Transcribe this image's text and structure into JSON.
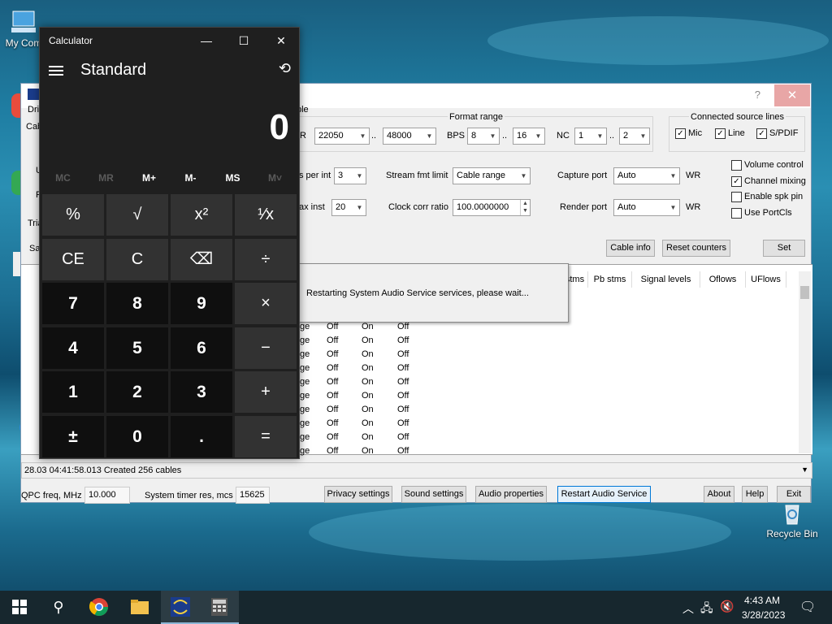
{
  "desktop": {
    "icons": [
      {
        "label": "My Com"
      },
      {
        "label": "Recycle Bin"
      }
    ]
  },
  "vac": {
    "title_help": "?",
    "close": "✕",
    "partial_labels": {
      "drv": "Driv",
      "cab": "Cab",
      "u": "U",
      "p": "P",
      "tria": "Tria",
      "sa": "Sa",
      "ca": "Ca",
      "ble": "ble",
      "r": "R"
    },
    "format_range": {
      "title": "Format range",
      "sr_from": "22050",
      "sr_to": "48000",
      "dots": "..",
      "bps_label": "BPS",
      "bps_from": "8",
      "bps_to": "16",
      "nc_label": "NC",
      "nc_from": "1",
      "nc_to": "2"
    },
    "connected": {
      "title": "Connected source lines",
      "mic": "Mic",
      "line": "Line",
      "spdif": "S/PDIF"
    },
    "settings": {
      "s_per_int_label": "s per int",
      "s_per_int": "3",
      "ax_inst_label": "ax inst",
      "ax_inst": "20",
      "stream_fmt_label": "Stream fmt limit",
      "stream_fmt": "Cable range",
      "clock_label": "Clock corr ratio",
      "clock": "100.0000000",
      "capture_label": "Capture port",
      "capture": "Auto",
      "capture_wr": "WR",
      "render_label": "Render port",
      "render": "Auto",
      "render_wr": "WR"
    },
    "options": {
      "volume": "Volume control",
      "mixing": "Channel mixing",
      "spk_pin": "Enable spk pin",
      "portcls": "Use PortCls"
    },
    "buttons": {
      "cable_info": "Cable info",
      "reset": "Reset counters",
      "set": "Set"
    },
    "table": {
      "headers": [
        "stms",
        "Pb stms",
        "Signal levels",
        "Oflows",
        "UFlows"
      ],
      "rows": [
        [
          "ge",
          "Off",
          "On",
          "Off"
        ],
        [
          "ge",
          "Off",
          "On",
          "Off"
        ],
        [
          "ge",
          "Off",
          "On",
          "Off"
        ],
        [
          "ge",
          "Off",
          "On",
          "Off"
        ],
        [
          "ge",
          "Off",
          "On",
          "Off"
        ],
        [
          "ge",
          "Off",
          "On",
          "Off"
        ],
        [
          "ge",
          "Off",
          "On",
          "Off"
        ],
        [
          "ge",
          "Off",
          "On",
          "Off"
        ],
        [
          "ge",
          "Off",
          "On",
          "Off"
        ],
        [
          "ge",
          "Off",
          "On",
          "Off"
        ]
      ]
    },
    "dialog": "Restarting System Audio Service services, please wait...",
    "status": "28.03   04:41:58.013  Created 256 cables",
    "bottom": {
      "qpc_label": "QPC freq, MHz",
      "qpc": "10.000",
      "timer_label": "System timer res, mcs",
      "timer": "15625",
      "privacy": "Privacy settings",
      "sound": "Sound settings",
      "audio_props": "Audio properties",
      "restart": "Restart Audio Service",
      "about": "About",
      "help": "Help",
      "exit": "Exit"
    }
  },
  "calc": {
    "title": "Calculator",
    "minimize": "—",
    "maximize": "☐",
    "close": "✕",
    "mode": "Standard",
    "history": "⟲",
    "display": "0",
    "memory": [
      "MC",
      "MR",
      "M+",
      "M-",
      "MS",
      "M˅"
    ],
    "keys": [
      [
        "%",
        "√",
        "x²",
        "¹⁄x"
      ],
      [
        "CE",
        "C",
        "⌫",
        "÷"
      ],
      [
        "7",
        "8",
        "9",
        "×"
      ],
      [
        "4",
        "5",
        "6",
        "−"
      ],
      [
        "1",
        "2",
        "3",
        "+"
      ],
      [
        "±",
        "0",
        ".",
        "="
      ]
    ]
  },
  "taskbar": {
    "time": "4:43 AM",
    "date": "3/28/2023"
  }
}
